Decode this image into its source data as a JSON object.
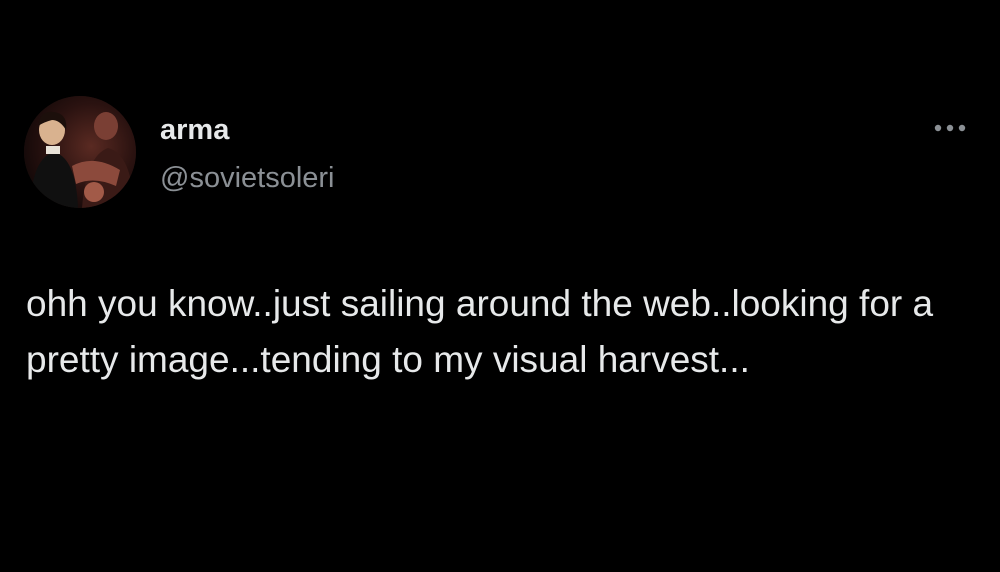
{
  "tweet": {
    "author": {
      "display_name": "arma",
      "handle": "@sovietsoleri",
      "avatar_icon": "profile-photo"
    },
    "more_icon": "more-dots-icon",
    "text": "ohh you know..just sailing around the web..looking for a pretty image...tending to my visual harvest..."
  },
  "colors": {
    "background": "#000000",
    "primary_text": "#e7e9ea",
    "secondary_text": "#8b9095"
  }
}
